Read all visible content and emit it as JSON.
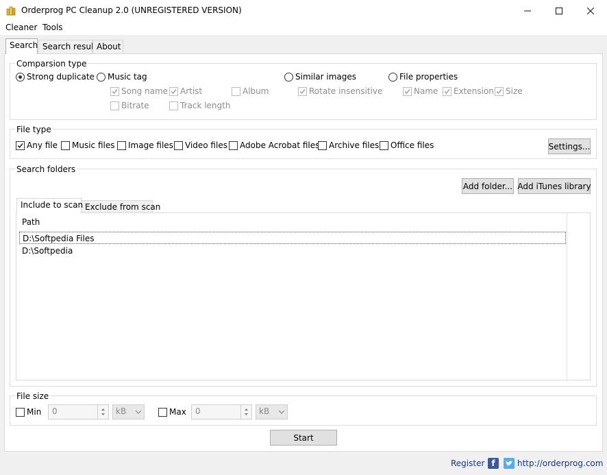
{
  "window": {
    "title": "Orderprog PC Cleanup 2.0 (UNREGISTERED VERSION)",
    "minimize_glyph": "—",
    "maximize_glyph": "☐",
    "close_glyph": "✕"
  },
  "menu": {
    "items": [
      "Cleaner",
      "Tools"
    ]
  },
  "tabs": [
    "Search",
    "Search result",
    "About"
  ],
  "comparison": {
    "label": "Comparsion type",
    "options": {
      "strong": "Strong duplicate",
      "music": "Music tag",
      "images": "Similar images",
      "props": "File properties"
    },
    "selected": "Strong duplicate",
    "music_sub": [
      "Song name",
      "Artist",
      "Album",
      "Bitrate",
      "Track length"
    ],
    "images_sub": [
      "Rotate insensitive"
    ],
    "props_sub": [
      "Name",
      "Extension",
      "Size"
    ]
  },
  "file_type": {
    "label": "File type",
    "options": [
      "Any file",
      "Music files",
      "Image files",
      "Video files",
      "Adobe Acrobat files",
      "Archive files",
      "Office files"
    ],
    "checked": [
      "Any file"
    ],
    "settings_button": "Settings..."
  },
  "search_folders": {
    "label": "Search folders",
    "add_folder_button": "Add folder...",
    "add_itunes_button": "Add iTunes library",
    "tabs": [
      "Include to scan",
      "Exclude from scan"
    ],
    "column_header": "Path",
    "rows": [
      "D:\\Softpedia Files",
      "D:\\Softpedia"
    ]
  },
  "file_size": {
    "label": "File size",
    "min_label": "Min",
    "min_value": "0",
    "min_unit": "kB",
    "max_label": "Max",
    "max_value": "0",
    "max_unit": "kB"
  },
  "start_button": "Start",
  "footer": {
    "register": "Register",
    "facebook_glyph": "f",
    "url": "http://orderprog.com"
  },
  "colors": {
    "accent_link": "#0a3a9b",
    "facebook": "#3b5998",
    "twitter": "#55acee"
  }
}
